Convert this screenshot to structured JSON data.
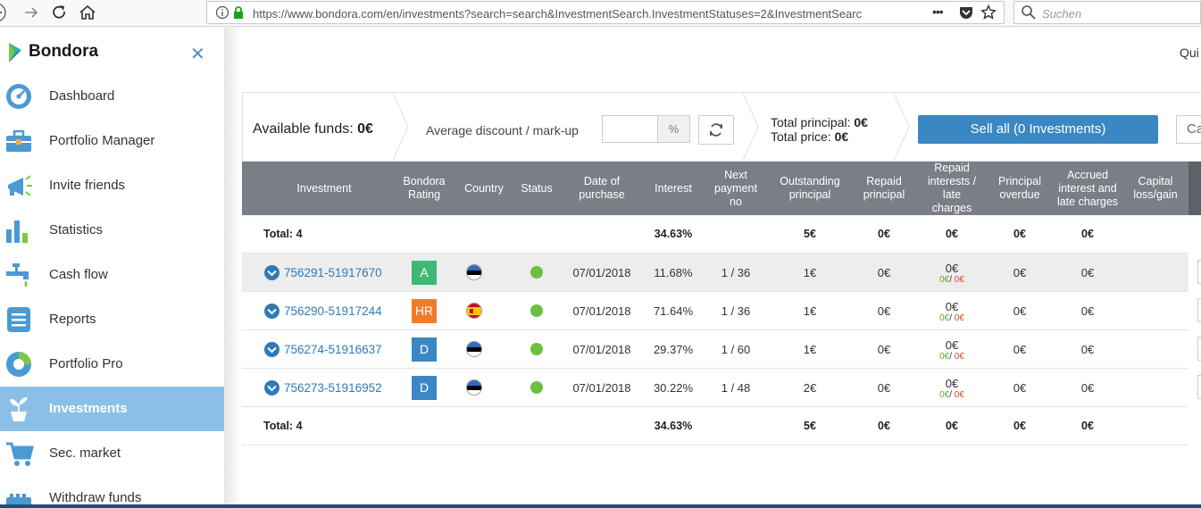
{
  "browser": {
    "url": "https://www.bondora.com/en/investments?search=search&InvestmentSearch.InvestmentStatuses=2&InvestmentSearc",
    "search_placeholder": "Suchen",
    "menu_dots": "•••"
  },
  "sidebar": {
    "brand": "Bondora",
    "items": [
      {
        "label": "Dashboard",
        "icon": "dashboard-icon"
      },
      {
        "label": "Portfolio Manager",
        "icon": "briefcase-icon"
      },
      {
        "label": "Invite friends",
        "icon": "megaphone-icon"
      },
      {
        "label": "Statistics",
        "icon": "bar-chart-icon"
      },
      {
        "label": "Cash flow",
        "icon": "faucet-icon"
      },
      {
        "label": "Reports",
        "icon": "document-icon"
      },
      {
        "label": "Portfolio Pro",
        "icon": "donut-chart-icon"
      },
      {
        "label": "Investments",
        "icon": "plant-icon",
        "active": true
      },
      {
        "label": "Sec. market",
        "icon": "cart-icon"
      },
      {
        "label": "Withdraw funds",
        "icon": "wallet-icon"
      }
    ]
  },
  "header": {
    "quick": "Qui"
  },
  "summary": {
    "available_label": "Available funds: ",
    "available_value": "0€",
    "discount_label": "Average discount / mark-up",
    "discount_value": "",
    "discount_unit": "%",
    "total_principal_label": "Total principal: ",
    "total_principal_value": "0€",
    "total_price_label": "Total price: ",
    "total_price_value": "0€",
    "sell_all_label": "Sell all (0 Investments)",
    "cancel_label": "Ca"
  },
  "table": {
    "headers": [
      "Investment",
      "Bondora Rating",
      "Country",
      "Status",
      "Date of purchase",
      "Interest",
      "Next payment no",
      "Outstanding principal",
      "Repaid principal",
      "Repaid interests / late charges",
      "Principal overdue",
      "Accrued interest and late charges",
      "Capital loss/gain"
    ],
    "total_top": {
      "label": "Total: 4",
      "interest": "34.63%",
      "outstanding": "5€",
      "repaid_principal": "0€",
      "repaid_interests": "0€",
      "principal_overdue": "0€",
      "accrued": "0€"
    },
    "rows": [
      {
        "id": "756291-51917670",
        "rating": "A",
        "rating_color": "#3fb876",
        "country": "EE",
        "date": "07/01/2018",
        "interest": "11.68%",
        "next_payment": "1 / 36",
        "outstanding": "1€",
        "repaid_principal": "0€",
        "repaid_interests": "0€",
        "sub_green": "0€",
        "sub_sep": "/ ",
        "sub_red": "0€",
        "principal_overdue": "0€",
        "accrued": "0€"
      },
      {
        "id": "756290-51917244",
        "rating": "HR",
        "rating_color": "#f07c2a",
        "country": "ES",
        "date": "07/01/2018",
        "interest": "71.64%",
        "next_payment": "1 / 36",
        "outstanding": "1€",
        "repaid_principal": "0€",
        "repaid_interests": "0€",
        "sub_green": "0€",
        "sub_sep": "/ ",
        "sub_red": "0€",
        "principal_overdue": "0€",
        "accrued": "0€"
      },
      {
        "id": "756274-51916637",
        "rating": "D",
        "rating_color": "#3a87c4",
        "country": "EE",
        "date": "07/01/2018",
        "interest": "29.37%",
        "next_payment": "1 / 60",
        "outstanding": "1€",
        "repaid_principal": "0€",
        "repaid_interests": "0€",
        "sub_green": "0€",
        "sub_sep": "/ ",
        "sub_red": "0€",
        "principal_overdue": "0€",
        "accrued": "0€"
      },
      {
        "id": "756273-51916952",
        "rating": "D",
        "rating_color": "#3a87c4",
        "country": "EE",
        "date": "07/01/2018",
        "interest": "30.22%",
        "next_payment": "1 / 48",
        "outstanding": "2€",
        "repaid_principal": "0€",
        "repaid_interests": "0€",
        "sub_green": "0€",
        "sub_sep": "/ ",
        "sub_red": "0€",
        "principal_overdue": "0€",
        "accrued": "0€"
      }
    ],
    "total_bottom": {
      "label": "Total: 4",
      "interest": "34.63%",
      "outstanding": "5€",
      "repaid_principal": "0€",
      "repaid_interests": "0€",
      "principal_overdue": "0€",
      "accrued": "0€"
    }
  }
}
